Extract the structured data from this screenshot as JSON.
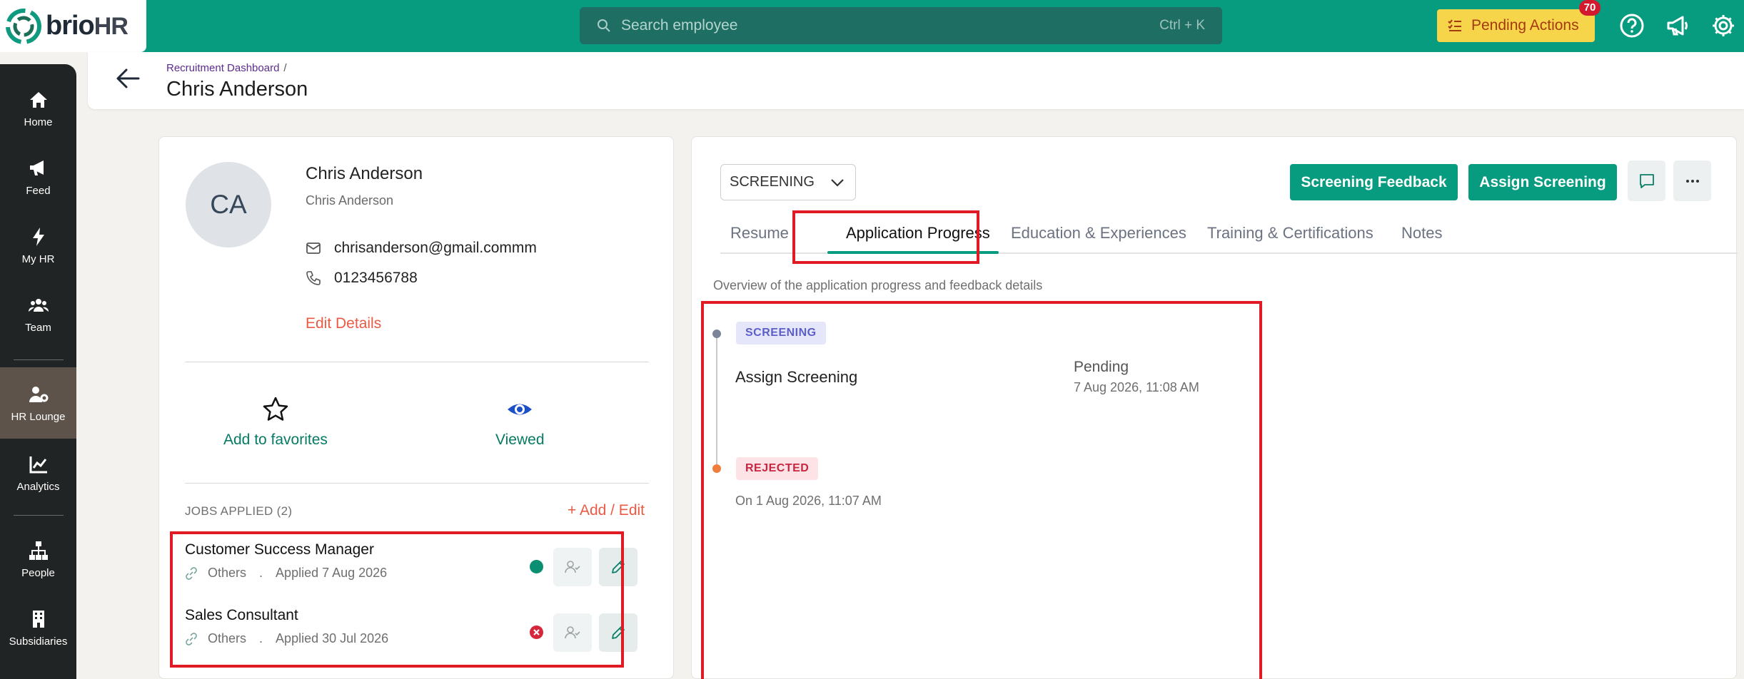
{
  "brand": {
    "name": "brio",
    "suffix": "HR",
    "colors": {
      "primary": "#079c7f",
      "accent": "#ea5a44",
      "highlight": "#e01b24"
    }
  },
  "topbar": {
    "search_placeholder": "Search employee",
    "search_shortcut": "Ctrl + K",
    "pending_label": "Pending Actions",
    "pending_count": "70",
    "icons": [
      "help-icon",
      "announcement-icon",
      "settings-icon"
    ]
  },
  "sidebar": {
    "items": [
      {
        "label": "Home",
        "icon": "home-icon"
      },
      {
        "label": "Feed",
        "icon": "megaphone-icon"
      },
      {
        "label": "My HR",
        "icon": "bolt-icon"
      },
      {
        "label": "Team",
        "icon": "team-icon"
      },
      {
        "label": "HR Lounge",
        "icon": "user-gear-icon",
        "active": true
      },
      {
        "label": "Analytics",
        "icon": "chart-icon"
      },
      {
        "label": "People",
        "icon": "org-chart-icon"
      },
      {
        "label": "Subsidiaries",
        "icon": "building-icon"
      }
    ]
  },
  "header": {
    "breadcrumb": "Recruitment Dashboard",
    "breadcrumb_sep": "/",
    "title": "Chris Anderson"
  },
  "profile": {
    "initials": "CA",
    "name": "Chris Anderson",
    "subtitle": "Chris Anderson",
    "email": "chrisanderson@gmail.commm",
    "phone": "0123456788",
    "edit_label": "Edit Details",
    "favorites_label": "Add to favorites",
    "viewed_label": "Viewed"
  },
  "jobs": {
    "title": "JOBS APPLIED (2)",
    "add_edit": "+ Add / Edit",
    "items": [
      {
        "title": "Customer Success Manager",
        "source": "Others",
        "sep": ".",
        "applied": "Applied 7 Aug 2026",
        "status": "active"
      },
      {
        "title": "Sales Consultant",
        "source": "Others",
        "sep": ".",
        "applied": "Applied 30 Jul 2026",
        "status": "rejected"
      }
    ]
  },
  "detail": {
    "stage": "SCREENING",
    "buttons": {
      "feedback": "Screening Feedback",
      "assign": "Assign Screening"
    },
    "tabs": [
      "Resume",
      "Application Progress",
      "Education & Experiences",
      "Training & Certifications",
      "Notes"
    ],
    "active_tab": "Application Progress",
    "overview": "Overview of the application progress and feedback details",
    "timeline": [
      {
        "tag": "SCREENING",
        "action": "Assign Screening",
        "status": "Pending",
        "time": "7 Aug 2026, 11:08 AM"
      },
      {
        "tag": "REJECTED",
        "time": "On 1 Aug 2026, 11:07 AM"
      }
    ]
  }
}
